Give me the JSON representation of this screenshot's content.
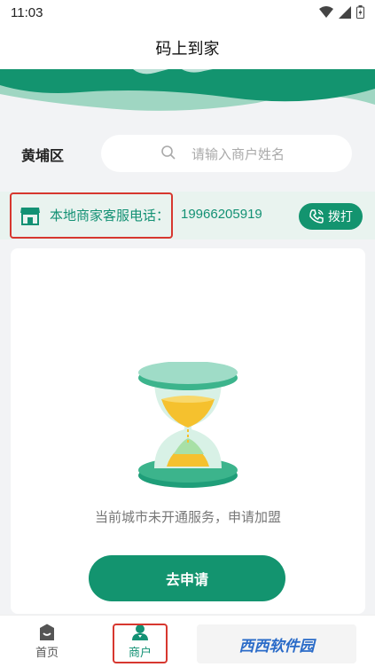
{
  "status_bar": {
    "time": "11:03"
  },
  "header": {
    "title": "码上到家"
  },
  "search": {
    "district": "黄埔区",
    "placeholder": "请输入商户姓名"
  },
  "hotline": {
    "label": "本地商家客服电话：",
    "number": "19966205919",
    "call_label": "拨打"
  },
  "empty_state": {
    "message": "当前城市未开通服务，申请加盟",
    "apply_label": "去申请"
  },
  "tab_bar": {
    "items": [
      {
        "label": "首页"
      },
      {
        "label": "商户"
      }
    ]
  },
  "watermark": {
    "text": "西西软件园"
  },
  "colors": {
    "accent": "#13946f",
    "highlight": "#d7372f",
    "background": "#f2f3f5"
  }
}
